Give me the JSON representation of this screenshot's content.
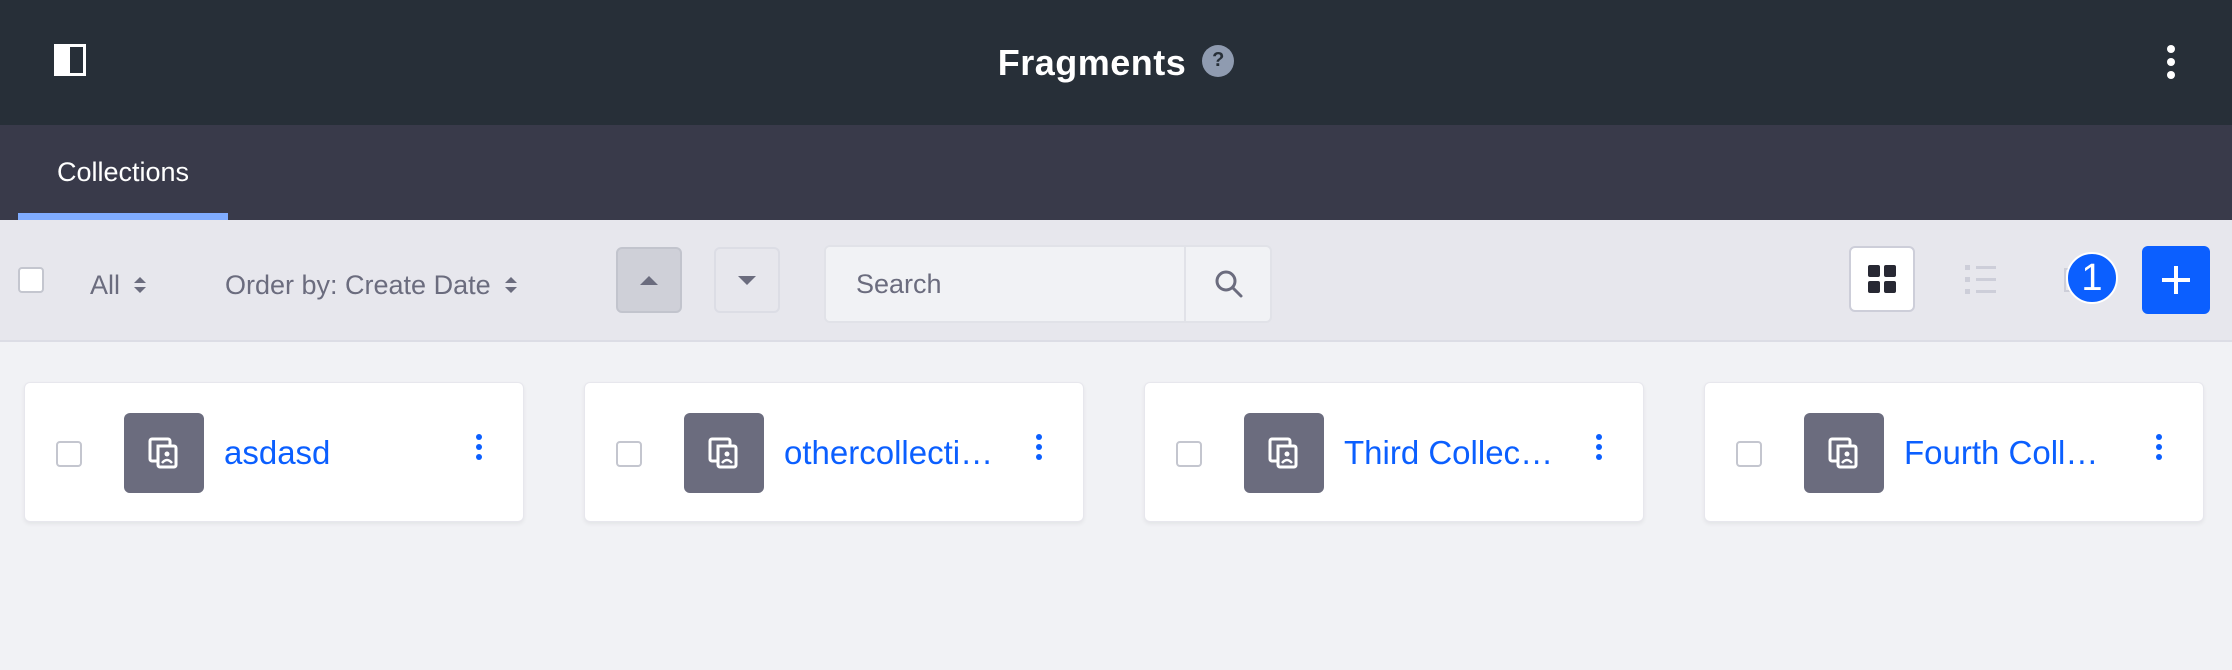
{
  "header": {
    "title": "Fragments",
    "help_icon": "?"
  },
  "navbar": {
    "tabs": [
      {
        "label": "Collections",
        "active": true
      }
    ]
  },
  "toolbar": {
    "filter_label": "All",
    "order_label": "Order by: Create Date",
    "search_placeholder": "Search",
    "badge_count": "1"
  },
  "cards": [
    {
      "name": "asdasd"
    },
    {
      "name": "othercollection"
    },
    {
      "name": "Third Collection"
    },
    {
      "name": "Fourth Collection"
    }
  ],
  "colors": {
    "header_bg": "#272f38",
    "nav_bg": "#393a4a",
    "accent": "#0b5fff",
    "tab_underline": "#80acff"
  },
  "icons": {
    "sidebar_toggle": "sidebar-toggle-icon",
    "help": "question-circle-icon",
    "header_menu": "ellipsis-v-icon",
    "search": "search-icon",
    "card_view": "cards-icon",
    "list_view": "list-icon",
    "table_view": "table-icon",
    "add": "plus-icon",
    "collection": "documents-icon"
  }
}
